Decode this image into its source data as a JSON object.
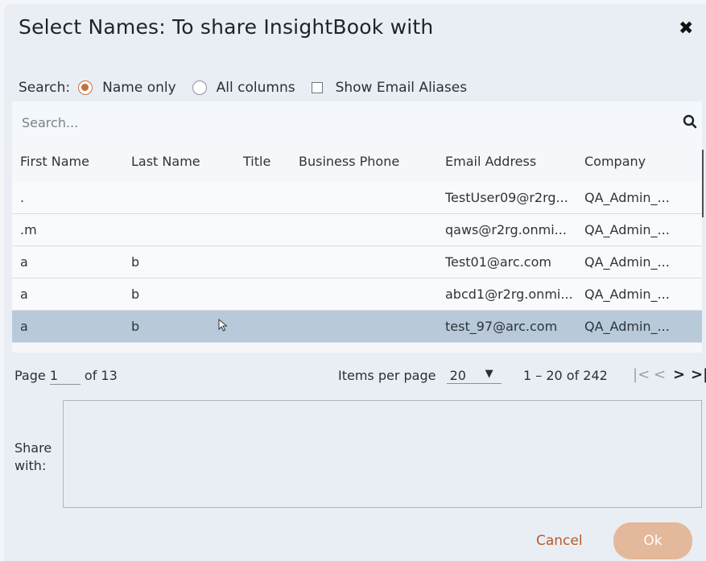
{
  "dialog": {
    "title": "Select Names: To share InsightBook with",
    "close_glyph": "✖"
  },
  "search_options": {
    "label": "Search:",
    "name_only": "Name only",
    "all_columns": "All columns",
    "show_email_aliases": "Show Email Aliases",
    "selected": "Name only"
  },
  "search": {
    "placeholder": "Search...",
    "value": ""
  },
  "table": {
    "columns": [
      "First Name",
      "Last Name",
      "Title",
      "Business Phone",
      "Email Address",
      "Company"
    ],
    "rows": [
      {
        "first": ".",
        "last": "",
        "title": "",
        "phone": "",
        "email": "TestUser09@r2rg...",
        "company": "QA_Admin_..."
      },
      {
        "first": ".m",
        "last": "",
        "title": "",
        "phone": "",
        "email": "qaws@r2rg.onmi...",
        "company": "QA_Admin_..."
      },
      {
        "first": "a",
        "last": "b",
        "title": "",
        "phone": "",
        "email": "Test01@arc.com",
        "company": "QA_Admin_..."
      },
      {
        "first": "a",
        "last": "b",
        "title": "",
        "phone": "",
        "email": "abcd1@r2rg.onmi...",
        "company": "QA_Admin_..."
      },
      {
        "first": "a",
        "last": "b",
        "title": "",
        "phone": "",
        "email": "test_97@arc.com",
        "company": "QA_Admin_..."
      }
    ],
    "selected_row": 4
  },
  "pager": {
    "page_label": "Page",
    "page_value": "1",
    "of_pages": "of 13",
    "items_per_page_label": "Items per page",
    "items_per_page": "20",
    "range": "1 – 20 of 242"
  },
  "share": {
    "label_line1": "Share",
    "label_line2": "with:",
    "value": ""
  },
  "actions": {
    "cancel": "Cancel",
    "ok": "Ok"
  },
  "colors": {
    "accent": "#c8703a",
    "selected_row": "#b8cad9",
    "ok_button": "#e3b89b",
    "cancel_text": "#b65b25"
  }
}
